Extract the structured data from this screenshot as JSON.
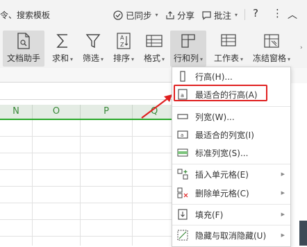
{
  "topbar": {
    "command_text": "令、搜索模板",
    "sync_label": "已同步",
    "share_label": "分享",
    "annotate_label": "批注",
    "help_label": "?",
    "more_label": "⋮",
    "collapse_label": "︿"
  },
  "ribbon": {
    "doc_helper": "文档助手",
    "sum": "求和",
    "filter": "筛选",
    "sort": "排序",
    "format": "格式",
    "row_col": "行和列",
    "worksheet": "工作表",
    "freeze": "冻结窗格"
  },
  "columns": [
    "N",
    "O",
    "P",
    "Q"
  ],
  "menu": {
    "items": [
      {
        "label": "行高(H)...",
        "icon": "row-height-icon",
        "submenu": false
      },
      {
        "label": "最适合的行高(A)",
        "icon": "best-fit-row-icon",
        "submenu": false
      },
      {
        "label": "列宽(W)...",
        "icon": "column-width-icon",
        "submenu": false
      },
      {
        "label": "最适合的列宽(I)",
        "icon": "best-fit-column-icon",
        "submenu": false
      },
      {
        "label": "标准列宽(S)...",
        "icon": "standard-width-icon",
        "submenu": false
      },
      {
        "label": "插入单元格(E)",
        "icon": "insert-cells-icon",
        "submenu": true
      },
      {
        "label": "删除单元格(C)",
        "icon": "delete-cells-icon",
        "submenu": true
      },
      {
        "label": "填充(F)",
        "icon": "fill-icon",
        "submenu": true
      },
      {
        "label": "隐藏与取消隐藏(U)",
        "icon": "hide-unhide-icon",
        "submenu": true
      }
    ]
  },
  "colors": {
    "accent_green": "#26a826",
    "highlight_red": "#e02020"
  }
}
